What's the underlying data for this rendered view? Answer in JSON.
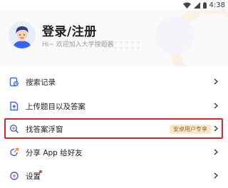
{
  "status_bar": {
    "time": "4:38"
  },
  "header": {
    "title": "登录/注册",
    "subtitle": "Hi~ 欢迎加入大学搜题酱"
  },
  "menu": [
    {
      "label": "搜索记录"
    },
    {
      "label": "上传题目以及答案"
    },
    {
      "label": "找答案浮窗",
      "badge": "安卓用户专享"
    },
    {
      "label": "分享 App 给好友"
    },
    {
      "label": "设置"
    }
  ],
  "colors": {
    "accent": "#3a63f2",
    "highlight_border": "#e0202a",
    "badge_bg": "#fbe7c9",
    "badge_text": "#9b6a2a"
  }
}
